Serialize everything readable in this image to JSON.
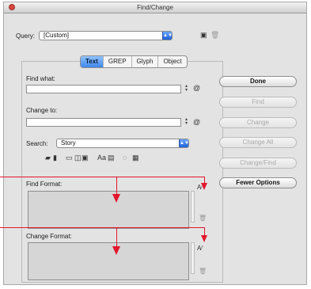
{
  "window": {
    "title": "Find/Change"
  },
  "query": {
    "label": "Query:",
    "value": "[Custom]"
  },
  "tabs": [
    {
      "label": "Text",
      "active": true
    },
    {
      "label": "GREP",
      "active": false
    },
    {
      "label": "Glyph",
      "active": false
    },
    {
      "label": "Object",
      "active": false
    }
  ],
  "find_what": {
    "label": "Find what:",
    "value": ""
  },
  "change_to": {
    "label": "Change to:",
    "value": ""
  },
  "search": {
    "label": "Search:",
    "value": "Story"
  },
  "find_format": {
    "label": "Find Format:"
  },
  "change_format": {
    "label": "Change Format:"
  },
  "buttons": {
    "done": "Done",
    "find": "Find",
    "change": "Change",
    "change_all": "Change All",
    "change_find": "Change/Find",
    "fewer_options": "Fewer Options"
  },
  "icons": {
    "save_query": "floppy-disk-icon",
    "delete_query": "trash-icon",
    "special_chars": "at-sign-magnifier-icon"
  },
  "colors": {
    "annotation_red": "#e2162c",
    "accent_blue": "#3f86ea"
  }
}
